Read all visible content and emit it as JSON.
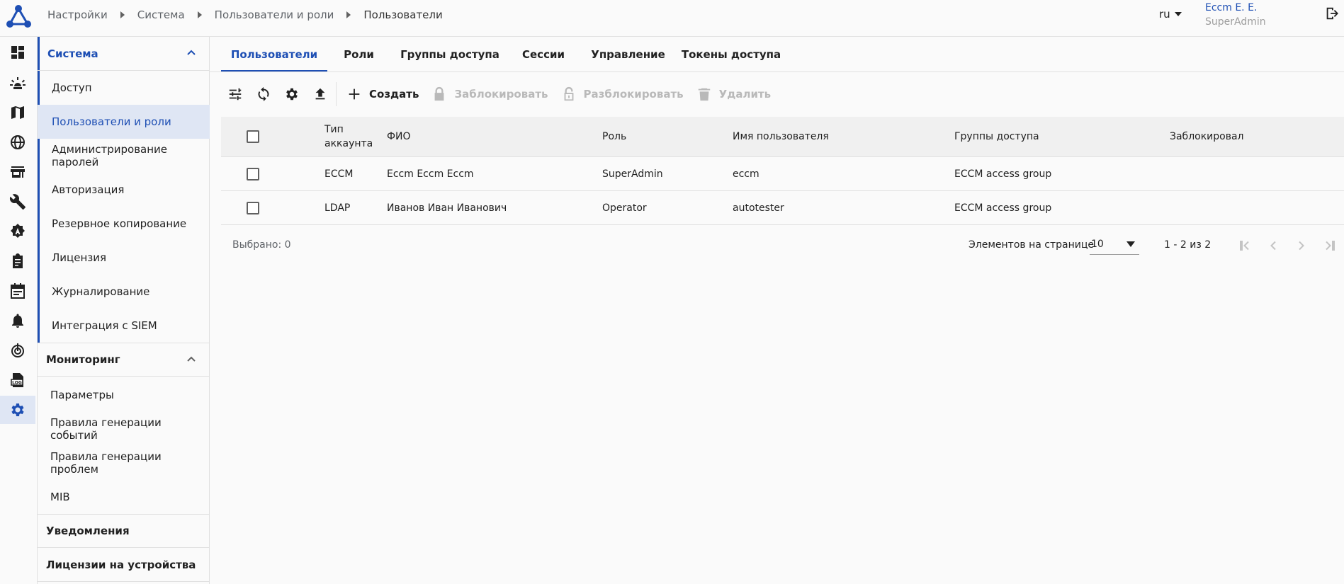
{
  "header": {
    "breadcrumb": [
      "Настройки",
      "Система",
      "Пользователи и роли",
      "Пользователи"
    ],
    "language": "ru",
    "user_name": "Eccm E. E.",
    "user_role": "SuperAdmin"
  },
  "rail": {
    "icons": [
      "dashboard-icon",
      "alarm-icon",
      "map-icon",
      "globe-icon",
      "store-icon",
      "wrench-icon",
      "admin-icon",
      "clipboard-icon",
      "calendar-icon",
      "bell-icon",
      "monitor-icon",
      "log-icon",
      "settings-icon"
    ],
    "active": "settings-icon"
  },
  "sidemenu": {
    "sections": [
      {
        "title": "Система",
        "expanded": true,
        "items": [
          "Доступ",
          "Пользователи и роли",
          "Администрирование паролей",
          "Авторизация",
          "Резервное копирование",
          "Лицензия",
          "Журналирование",
          "Интеграция с SIEM"
        ],
        "active": "Пользователи и роли"
      },
      {
        "title": "Мониторинг",
        "expanded": true,
        "items": [
          "Параметры",
          "Правила генерации событий",
          "Правила генерации проблем",
          "MIB"
        ]
      },
      {
        "title": "Уведомления"
      },
      {
        "title": "Лицензии на устройства"
      }
    ]
  },
  "tabs": [
    "Пользователи",
    "Роли",
    "Группы доступа",
    "Сессии",
    "Управление",
    "Токены доступа"
  ],
  "active_tab": "Пользователи",
  "toolbar": {
    "icons": [
      "filter-settings-icon",
      "refresh-icon",
      "gear-icon",
      "upload-icon"
    ],
    "create": "Создать",
    "block": "Заблокировать",
    "unblock": "Разблокировать",
    "delete": "Удалить"
  },
  "table": {
    "columns": [
      "Тип аккаунта",
      "ФИО",
      "Роль",
      "Имя пользователя",
      "Группы доступа",
      "Заблокировал"
    ],
    "rows": [
      [
        "ECCM",
        "Eccm Eccm Eccm",
        "SuperAdmin",
        "eccm",
        "ECCM access group",
        ""
      ],
      [
        "LDAP",
        "Иванов Иван Иванович",
        "Operator",
        "autotester",
        "ECCM access group",
        ""
      ]
    ]
  },
  "footer": {
    "selected": "Выбрано: 0",
    "per_page_label": "Элементов на странице",
    "per_page": "10",
    "range": "1 - 2 из 2"
  },
  "colors": {
    "accent": "#1e4fb4",
    "active_bg": "#dfe6f4",
    "disabled": "#b9b9b9"
  }
}
